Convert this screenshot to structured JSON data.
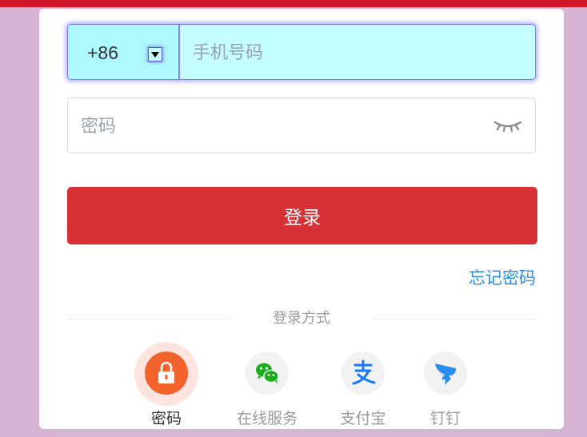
{
  "phone": {
    "country_code": "+86",
    "placeholder": "手机号码",
    "value": ""
  },
  "password": {
    "placeholder": "密码",
    "value": ""
  },
  "login_button": "登录",
  "forgot_password": "忘记密码",
  "login_methods": {
    "title": "登录方式",
    "items": [
      {
        "label": "密码",
        "icon": "lock-icon",
        "active": true
      },
      {
        "label": "在线服务",
        "icon": "wechat-icon",
        "active": false
      },
      {
        "label": "支付宝",
        "icon": "alipay-icon",
        "active": false
      },
      {
        "label": "钉钉",
        "icon": "dingtalk-icon",
        "active": false
      }
    ]
  },
  "colors": {
    "header": "#d0182a",
    "background": "#d8b4d4",
    "login_button": "#d83135",
    "link": "#2a8ee6",
    "active_method": "#f2642c"
  }
}
